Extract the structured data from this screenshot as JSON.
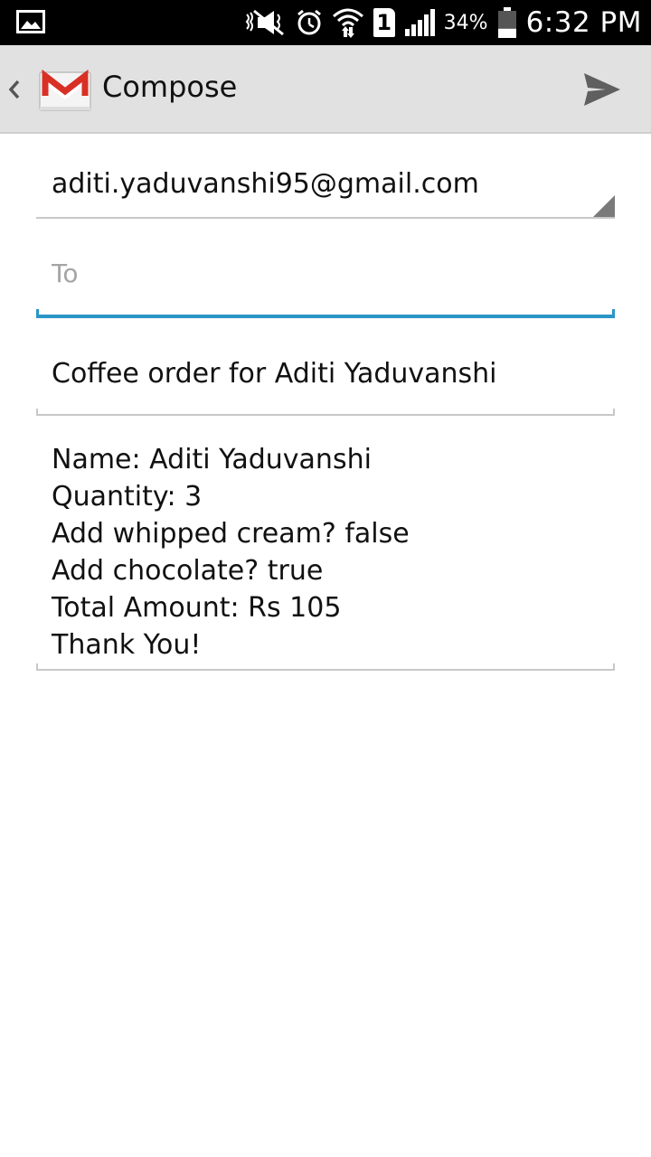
{
  "status_bar": {
    "left_icon": "gallery-notification-icon",
    "icons": [
      "mute-icon",
      "alarm-icon",
      "wifi-icon",
      "sim-1-icon",
      "signal-icon",
      "battery-icon"
    ],
    "sim_label": "1",
    "battery_percent": "34%",
    "battery_level": 0.34,
    "time": "6:32 PM"
  },
  "action_bar": {
    "title": "Compose",
    "up_icon": "chevron-left-icon",
    "logo_icon": "gmail-logo-icon",
    "send_icon": "send-icon"
  },
  "compose": {
    "from": "aditi.yaduvanshi95@gmail.com",
    "to_value": "",
    "to_placeholder": "To",
    "subject": "Coffee order for Aditi Yaduvanshi",
    "body_lines": [
      "Name:  Aditi Yaduvanshi",
      "Quantity:  3",
      "Add whipped cream?  false",
      "Add chocolate?  true",
      "Total Amount:  Rs 105",
      "Thank You!"
    ]
  },
  "colors": {
    "status_bar_bg": "#000000",
    "action_bar_bg": "#e1e1e1",
    "focus_accent": "#2a95c6",
    "gmail_red": "#d93025",
    "divider": "#c8c8c8"
  }
}
